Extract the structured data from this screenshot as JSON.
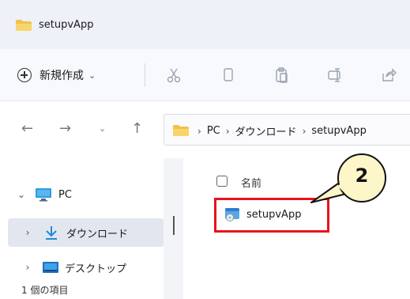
{
  "window": {
    "title": "setupvApp"
  },
  "toolbar": {
    "new_label": "新規作成",
    "new_caret": "⌄",
    "icons": [
      "cut-icon",
      "copy-icon",
      "paste-icon",
      "rename-icon",
      "share-icon"
    ]
  },
  "navigation": {
    "back": "←",
    "forward": "→",
    "recent": "⌄",
    "up": "↑"
  },
  "address": {
    "crumbs": [
      "PC",
      "ダウンロード",
      "setupvApp"
    ],
    "separator": "›"
  },
  "navpane": {
    "items": [
      {
        "label": "PC",
        "chevron": "⌄",
        "icon": "monitor-icon"
      },
      {
        "label": "ダウンロード",
        "chevron": "›",
        "icon": "download-arrow-icon",
        "selected": true
      },
      {
        "label": "デスクトップ",
        "chevron": "›",
        "icon": "desktop-icon"
      }
    ]
  },
  "filelist": {
    "column_name": "名前",
    "items": [
      {
        "name": "setupvApp",
        "icon": "installer-icon"
      }
    ]
  },
  "annotation": {
    "step": "2",
    "highlight_color": "#e8141c",
    "callout_fill": "#fdf6c8"
  },
  "status": {
    "text": "1 個の項目"
  },
  "colors": {
    "folder": "#f3c14b",
    "accent": "#2f7ad8",
    "download": "#1f8bd6"
  }
}
